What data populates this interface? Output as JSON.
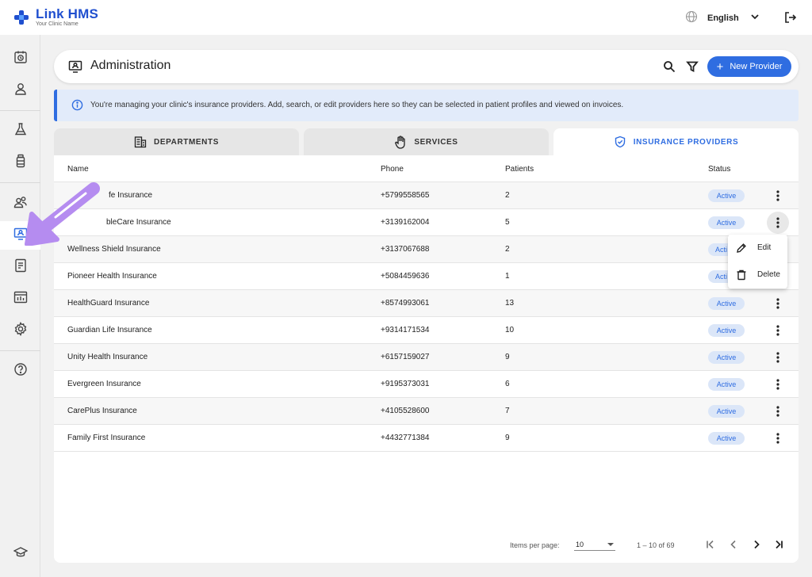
{
  "app": {
    "name": "Link HMS",
    "subtitle": "Your Clinic Name"
  },
  "topbar": {
    "language": "English",
    "globe_icon": "globe-icon",
    "logout_icon": "logout-icon"
  },
  "sidebar": {
    "items": [
      {
        "name": "appointments",
        "icon": "calendar-clock-icon"
      },
      {
        "name": "patients",
        "icon": "person-icon"
      },
      {
        "name": "lab",
        "icon": "flask-icon"
      },
      {
        "name": "pharmacy",
        "icon": "medicine-bottle-icon"
      },
      {
        "name": "staff",
        "icon": "people-icon"
      },
      {
        "name": "administration",
        "icon": "monitor-person-icon",
        "active": true
      },
      {
        "name": "billing",
        "icon": "invoice-icon"
      },
      {
        "name": "reports",
        "icon": "chart-icon"
      },
      {
        "name": "settings",
        "icon": "gear-icon"
      },
      {
        "name": "help",
        "icon": "help-circle-icon"
      },
      {
        "name": "training",
        "icon": "graduation-cap-icon"
      }
    ]
  },
  "header": {
    "title": "Administration",
    "new_button": "New Provider"
  },
  "banner": {
    "text": "You're managing your clinic's insurance providers. Add, search, or edit providers here so they can be selected in patient profiles and viewed on invoices."
  },
  "tabs": [
    {
      "label": "DEPARTMENTS",
      "active": false
    },
    {
      "label": "SERVICES",
      "active": false
    },
    {
      "label": "INSURANCE PROVIDERS",
      "active": true
    }
  ],
  "table": {
    "columns": {
      "name": "Name",
      "phone": "Phone",
      "patients": "Patients",
      "status": "Status"
    },
    "rows": [
      {
        "name": "fe Insurance",
        "phone": "+5799558565",
        "patients": "2",
        "status": "Active"
      },
      {
        "name": "bleCare Insurance",
        "phone": "+3139162004",
        "patients": "5",
        "status": "Active"
      },
      {
        "name": "Wellness Shield Insurance",
        "phone": "+3137067688",
        "patients": "2",
        "status": "Acti"
      },
      {
        "name": "Pioneer Health Insurance",
        "phone": "+5084459636",
        "patients": "1",
        "status": "Acti"
      },
      {
        "name": "HealthGuard Insurance",
        "phone": "+8574993061",
        "patients": "13",
        "status": "Active"
      },
      {
        "name": "Guardian Life Insurance",
        "phone": "+9314171534",
        "patients": "10",
        "status": "Active"
      },
      {
        "name": "Unity Health Insurance",
        "phone": "+6157159027",
        "patients": "9",
        "status": "Active"
      },
      {
        "name": "Evergreen Insurance",
        "phone": "+9195373031",
        "patients": "6",
        "status": "Active"
      },
      {
        "name": "CarePlus Insurance",
        "phone": "+4105528600",
        "patients": "7",
        "status": "Active"
      },
      {
        "name": "Family First Insurance",
        "phone": "+4432771384",
        "patients": "9",
        "status": "Active"
      }
    ]
  },
  "context_menu": {
    "edit": "Edit",
    "delete": "Delete"
  },
  "pagination": {
    "label": "Items per page:",
    "per_page": "10",
    "range": "1 – 10 of 69"
  },
  "colors": {
    "accent": "#2f6de1",
    "brand": "#1f4fcf",
    "badge_bg": "#dbe6f8",
    "pointer": "#b58cf0"
  }
}
